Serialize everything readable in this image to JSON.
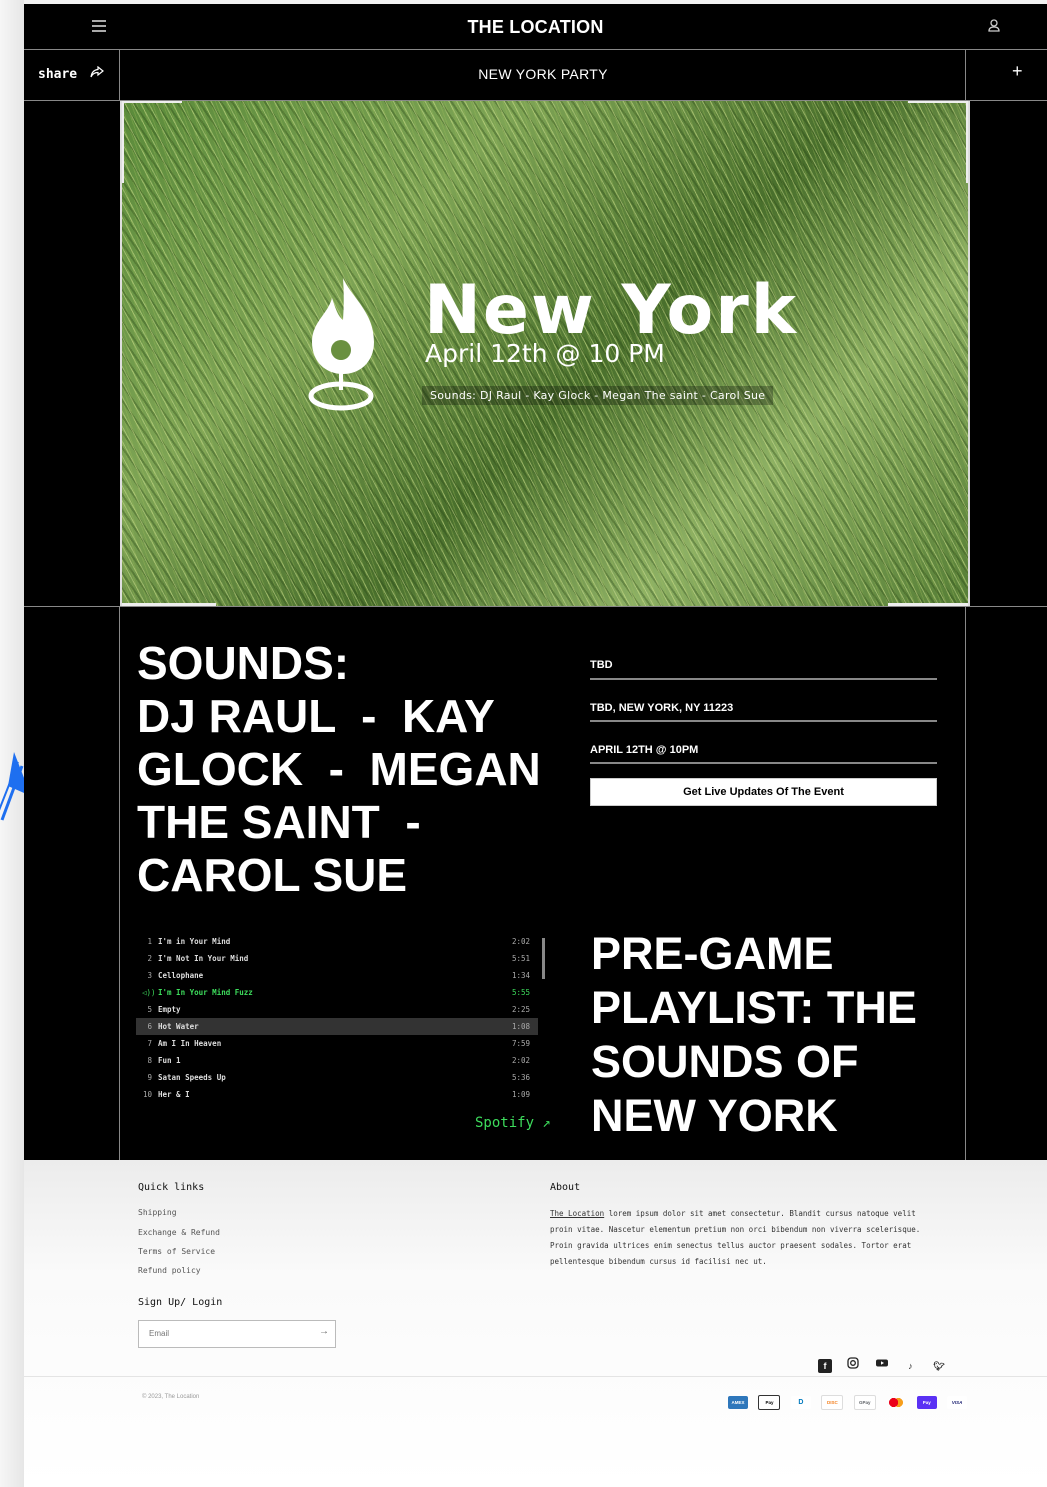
{
  "header": {
    "brand": "THE LOCATION",
    "menu_icon": "hamburger-menu-icon",
    "account_icon": "user-icon"
  },
  "subheader": {
    "share_label": "share",
    "share_icon": "share-icon",
    "title": "NEW YORK PARTY",
    "plus_label": "+"
  },
  "hero": {
    "logo_icon": "flame-location-pin-icon",
    "city": "New York",
    "date": "April 12th @ 10 PM",
    "sounds_line": "Sounds: DJ Raul  -  Kay Glock  -  Megan The saint  -  Carol Sue"
  },
  "event": {
    "sounds_heading": "SOUNDS:\nDJ RAUL  -  KAY GLOCK  -  MEGAN THE SAINT  -  CAROL SUE",
    "venue": "TBD",
    "address": "TBD, NEW YORK, NY 11223",
    "datetime": "APRIL 12TH @ 10PM",
    "updates_button": "Get Live Updates Of The Event"
  },
  "playlist": {
    "tracks": [
      {
        "num": "1",
        "title": "I'm in Your Mind",
        "duration": "2:02"
      },
      {
        "num": "2",
        "title": "I'm Not In Your Mind",
        "duration": "5:51"
      },
      {
        "num": "3",
        "title": "Cellophane",
        "duration": "1:34"
      },
      {
        "num": "◁))",
        "title": "I'm In Your Mind Fuzz",
        "duration": "5:55"
      },
      {
        "num": "5",
        "title": "Empty",
        "duration": "2:25"
      },
      {
        "num": "6",
        "title": "Hot Water",
        "duration": "1:08"
      },
      {
        "num": "7",
        "title": "Am I In Heaven",
        "duration": "7:59"
      },
      {
        "num": "8",
        "title": "Fun 1",
        "duration": "2:02"
      },
      {
        "num": "9",
        "title": "Satan Speeds Up",
        "duration": "5:36"
      },
      {
        "num": "10",
        "title": "Her & I",
        "duration": "1:09"
      }
    ],
    "spotify_label": "Spotify ↗",
    "heading": "PRE-GAME PLAYLIST: THE SOUNDS OF NEW YORK"
  },
  "footer": {
    "quick_links_heading": "Quick links",
    "links": [
      "Shipping",
      "Exchange & Refund",
      "Terms of Service",
      "Refund policy"
    ],
    "about_heading": "About",
    "about_link": "The Location",
    "about_text": " lorem ipsum dolor sit amet consectetur. Blandit cursus natoque velit proin vitae. Nascetur elementum pretium non orci bibendum non viverra scelerisque. Proin gravida ultrices enim senectus tellus auctor praesent sodales. Tortor erat pellentesque bibendum cursus id facilisi nec ut.",
    "signup_heading": "Sign Up/ Login",
    "email_placeholder": "Email",
    "email_arrow": "→",
    "social_icons": [
      "facebook-icon",
      "instagram-icon",
      "youtube-icon",
      "tiktok-icon",
      "twitter-icon"
    ],
    "copyright": "© 2023, The Location",
    "payment_icons": [
      {
        "icon": "amex-icon",
        "label": "AMEX"
      },
      {
        "icon": "apple-pay-icon",
        "label": "Pay"
      },
      {
        "icon": "diners-club-icon",
        "label": "D"
      },
      {
        "icon": "discover-icon",
        "label": "DISC"
      },
      {
        "icon": "google-pay-icon",
        "label": "GPay"
      },
      {
        "icon": "mastercard-icon",
        "label": ""
      },
      {
        "icon": "shop-pay-icon",
        "label": "Pay"
      },
      {
        "icon": "visa-icon",
        "label": "VISA"
      }
    ]
  }
}
